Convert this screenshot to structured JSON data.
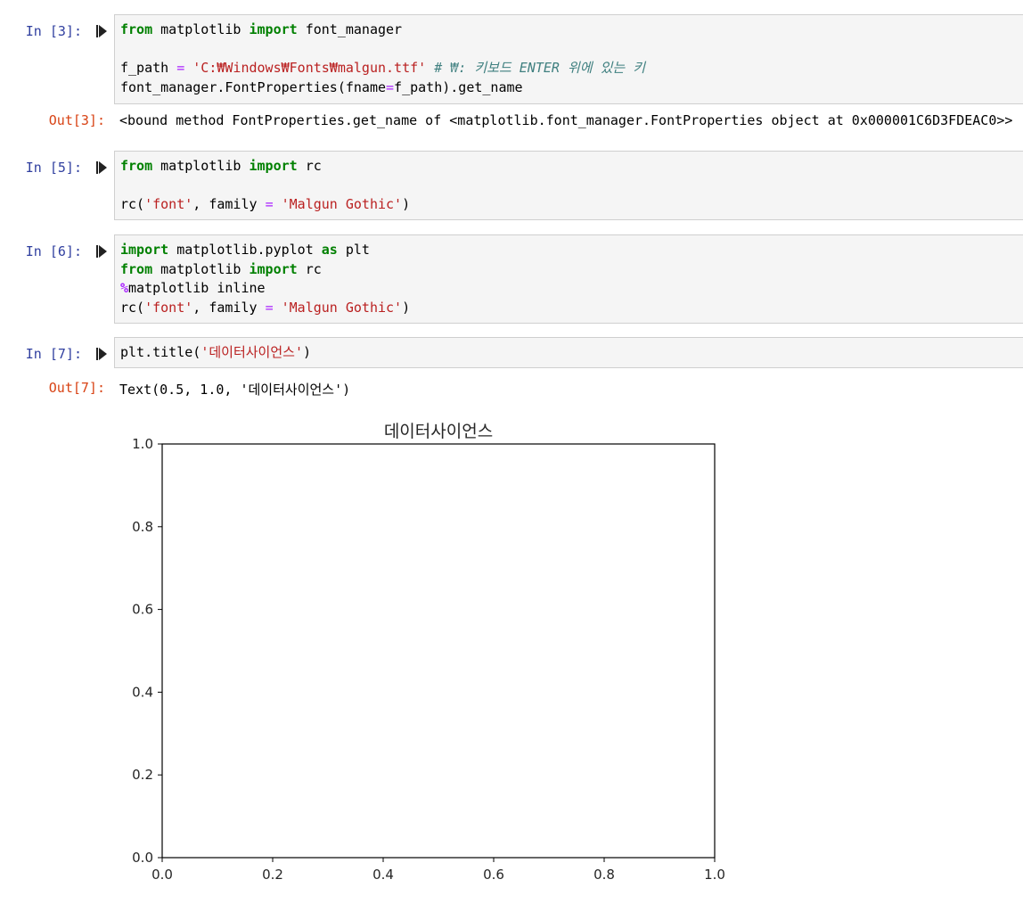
{
  "cells": [
    {
      "prompt": "In [3]:",
      "lines": [
        [
          {
            "t": "from",
            "c": "kw"
          },
          {
            "t": " matplotlib "
          },
          {
            "t": "import",
            "c": "kw"
          },
          {
            "t": " font_manager"
          }
        ],
        [],
        [
          {
            "t": "f_path "
          },
          {
            "t": "=",
            "c": "op"
          },
          {
            "t": " "
          },
          {
            "t": "'C:₩Windows₩Fonts₩malgun.ttf'",
            "c": "str"
          },
          {
            "t": " "
          },
          {
            "t": "# ₩: 키보드 ENTER 위에 있는 키",
            "c": "com"
          }
        ],
        [
          {
            "t": "font_manager.FontProperties(fname"
          },
          {
            "t": "=",
            "c": "op"
          },
          {
            "t": "f_path).get_name"
          }
        ]
      ],
      "out_prompt": "Out[3]:",
      "output": "<bound method FontProperties.get_name of <matplotlib.font_manager.FontProperties object at 0x000001C6D3FDEAC0>>"
    },
    {
      "prompt": "In [5]:",
      "lines": [
        [
          {
            "t": "from",
            "c": "kw"
          },
          {
            "t": " matplotlib "
          },
          {
            "t": "import",
            "c": "kw"
          },
          {
            "t": " rc"
          }
        ],
        [],
        [
          {
            "t": "rc("
          },
          {
            "t": "'font'",
            "c": "str"
          },
          {
            "t": ", family "
          },
          {
            "t": "=",
            "c": "op"
          },
          {
            "t": " "
          },
          {
            "t": "'Malgun Gothic'",
            "c": "str"
          },
          {
            "t": ")"
          }
        ]
      ]
    },
    {
      "prompt": "In [6]:",
      "lines": [
        [
          {
            "t": "import",
            "c": "kw"
          },
          {
            "t": " matplotlib.pyplot "
          },
          {
            "t": "as",
            "c": "kw"
          },
          {
            "t": " plt"
          }
        ],
        [
          {
            "t": "from",
            "c": "kw"
          },
          {
            "t": " matplotlib "
          },
          {
            "t": "import",
            "c": "kw"
          },
          {
            "t": " rc"
          }
        ],
        [
          {
            "t": "%",
            "c": "magic"
          },
          {
            "t": "matplotlib inline"
          }
        ],
        [
          {
            "t": "rc("
          },
          {
            "t": "'font'",
            "c": "str"
          },
          {
            "t": ", family "
          },
          {
            "t": "=",
            "c": "op"
          },
          {
            "t": " "
          },
          {
            "t": "'Malgun Gothic'",
            "c": "str"
          },
          {
            "t": ")"
          }
        ]
      ]
    },
    {
      "prompt": "In [7]:",
      "lines": [
        [
          {
            "t": "plt.title("
          },
          {
            "t": "'데이터사이언스'",
            "c": "str"
          },
          {
            "t": ")"
          }
        ]
      ],
      "out_prompt": "Out[7]:",
      "output": "Text(0.5, 1.0, '데이터사이언스')"
    }
  ],
  "chart_data": {
    "type": "line",
    "title": "데이터사이언스",
    "xlabel": "",
    "ylabel": "",
    "xlim": [
      0.0,
      1.0
    ],
    "ylim": [
      0.0,
      1.0
    ],
    "xticks": [
      "0.0",
      "0.2",
      "0.4",
      "0.6",
      "0.8",
      "1.0"
    ],
    "yticks": [
      "0.0",
      "0.2",
      "0.4",
      "0.6",
      "0.8",
      "1.0"
    ],
    "series": [],
    "grid": false
  },
  "colors": {
    "in_prompt": "#303f9f",
    "out_prompt": "#d84315",
    "keyword": "#008000",
    "string": "#ba2121",
    "operator": "#aa22ff",
    "comment": "#408080"
  },
  "icons": {
    "run": "run-cell-icon"
  }
}
